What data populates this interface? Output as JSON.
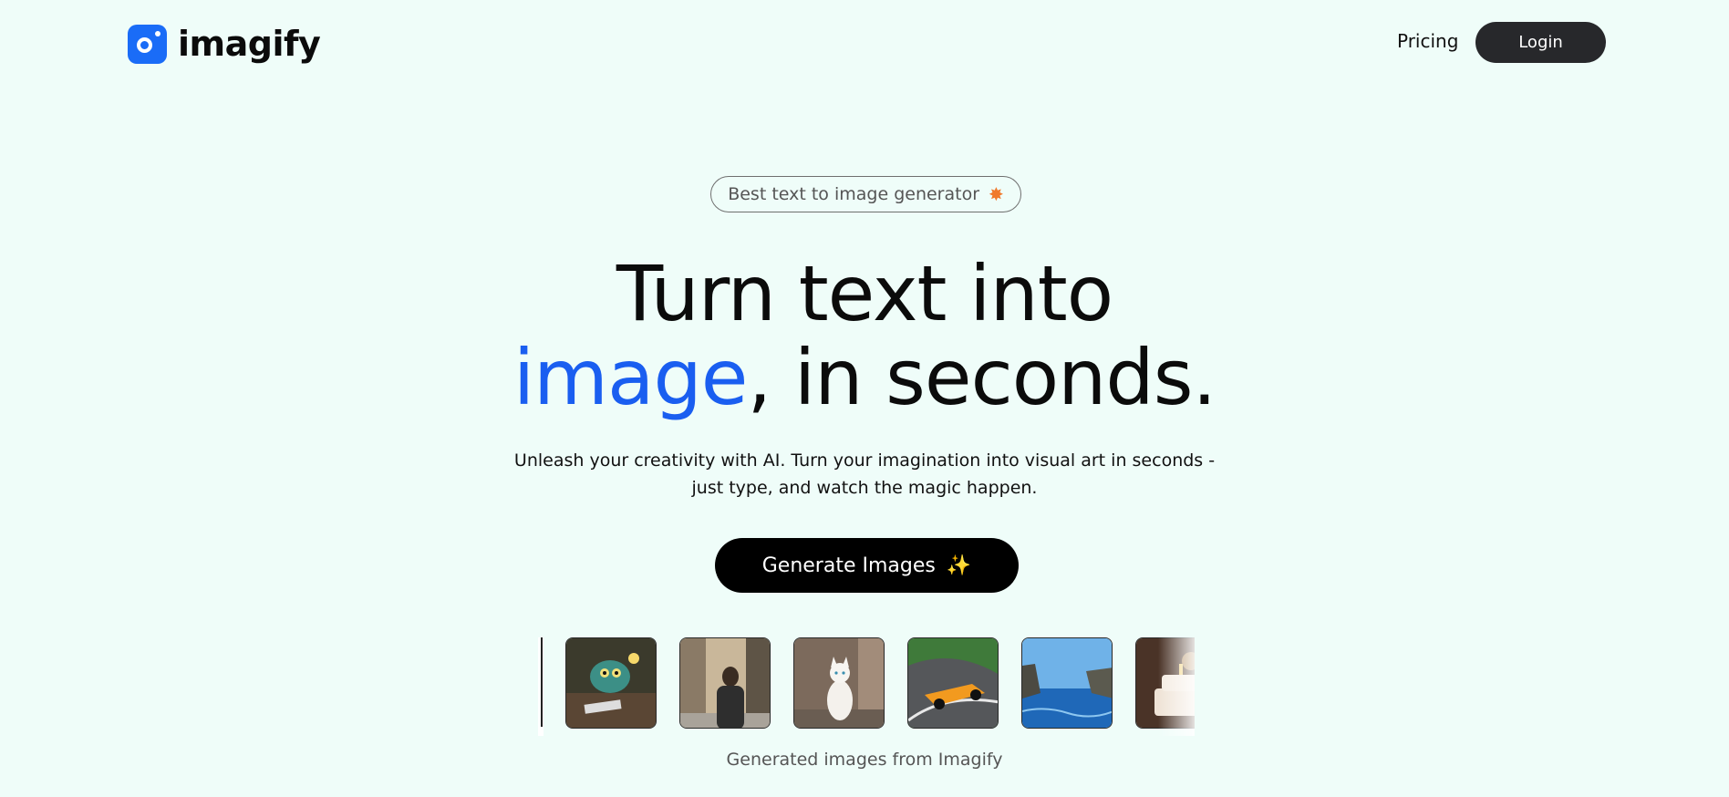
{
  "header": {
    "brand": "imagify",
    "nav": {
      "pricing": "Pricing",
      "login": "Login"
    }
  },
  "hero": {
    "badge": "Best text to image generator",
    "badge_icon": "star-icon",
    "title_line1": "Turn text into",
    "title_accent": "image",
    "title_rest": ", in seconds.",
    "subtitle": "Unleash your creativity with AI. Turn your imagination into visual art in seconds - just type, and watch the magic happen.",
    "cta_label": "Generate Images",
    "cta_icon": "sparkles-icon"
  },
  "gallery": {
    "caption": "Generated images from Imagify",
    "images": [
      "monster-at-desk-image",
      "man-in-street-image",
      "white-cat-image",
      "race-car-image",
      "sea-coast-image",
      "cake-image"
    ]
  },
  "colors": {
    "background": "#effdf9",
    "accent": "#1a5ef0",
    "brand_icon": "#1a6cf7",
    "button_dark": "#000000"
  }
}
